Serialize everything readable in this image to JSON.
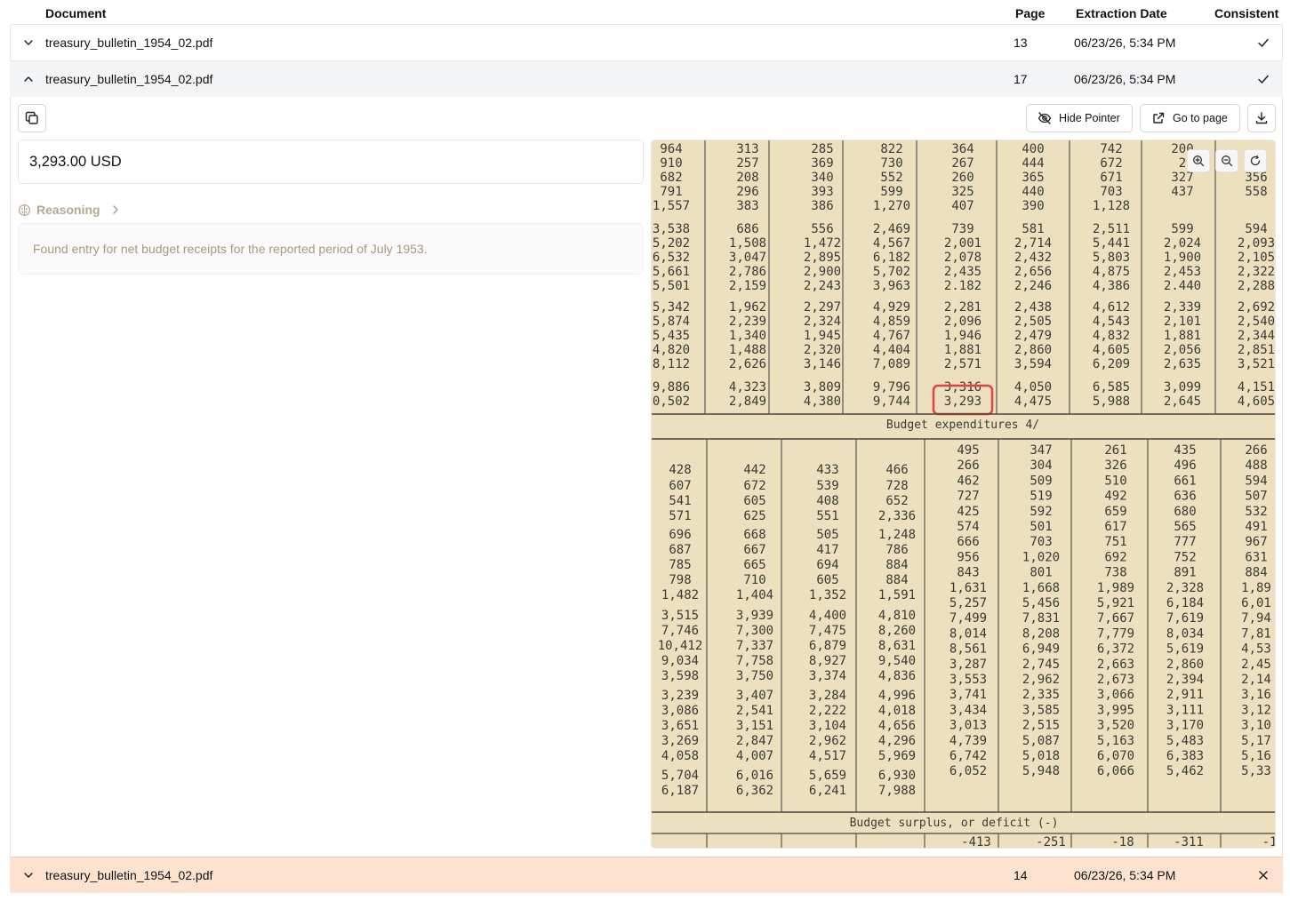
{
  "table": {
    "columns": {
      "document": "Document",
      "page": "Page",
      "extraction_date": "Extraction Date",
      "consistent": "Consistent"
    },
    "rows": [
      {
        "document": "treasury_bulletin_1954_02.pdf",
        "page": "13",
        "date": "06/23/26, 5:34 PM",
        "consistent": true,
        "expanded": false
      },
      {
        "document": "treasury_bulletin_1954_02.pdf",
        "page": "17",
        "date": "06/23/26, 5:34 PM",
        "consistent": true,
        "expanded": true
      },
      {
        "document": "treasury_bulletin_1954_02.pdf",
        "page": "14",
        "date": "06/23/26, 5:34 PM",
        "consistent": false,
        "expanded": false
      }
    ]
  },
  "detail": {
    "hide_pointer_label": "Hide Pointer",
    "go_to_page_label": "Go to page",
    "extracted_value": "3,293.00 USD",
    "reasoning_label": "Reasoning",
    "reasoning_text": "Found entry for net budget receipts for the reported period of July 1953."
  },
  "document_image": {
    "upper_columns": [
      [
        "964",
        "910",
        "682",
        "791",
        "1,557",
        "3,538",
        "5,202",
        "6,532",
        "5,661",
        "5,501",
        "5,342",
        "5,874",
        "5,435",
        "4,820",
        "8,112",
        "9,886",
        "0,502"
      ],
      [
        "313",
        "257",
        "208",
        "296",
        "383",
        "686",
        "1,508",
        "3,047",
        "2,786",
        "2,159",
        "1,962",
        "2,239",
        "1,340",
        "1,488",
        "2,626",
        "4,323",
        "2,849"
      ],
      [
        "285",
        "369",
        "340",
        "393",
        "386",
        "556",
        "1,472",
        "2,895",
        "2,900",
        "2,243",
        "2,297",
        "2,324",
        "1,945",
        "2,320",
        "3,146",
        "3,809",
        "4,380"
      ],
      [
        "822",
        "730",
        "552",
        "599",
        "1,270",
        "2,469",
        "4,567",
        "6,182",
        "5,702",
        "3,963",
        "4,929",
        "4,859",
        "4,767",
        "4,404",
        "7,089",
        "9,796",
        "9,744"
      ],
      [
        "364",
        "267",
        "260",
        "325",
        "407",
        "739",
        "2,001",
        "2,078",
        "2,435",
        "2.182",
        "2,281",
        "2,096",
        "1,946",
        "1,881",
        "2,571",
        "3,316",
        "3,293"
      ],
      [
        "400",
        "444",
        "365",
        "440",
        "390",
        "581",
        "2,714",
        "2,432",
        "2,656",
        "2,246",
        "2,438",
        "2,505",
        "2,479",
        "2,860",
        "3,594",
        "4,050",
        "4,475"
      ],
      [
        "742",
        "672",
        "671",
        "703",
        "1,128",
        "2,511",
        "5,441",
        "5,803",
        "4,875",
        "4,386",
        "4,612",
        "4,543",
        "4,832",
        "4,605",
        "6,209",
        "6,585",
        "5,988"
      ],
      [
        "200",
        "2",
        "327",
        "437",
        "",
        "599",
        "2,024",
        "1,900",
        "2,453",
        "2.440",
        "2,339",
        "2,101",
        "1,881",
        "2,056",
        "2,635",
        "3,099",
        "2,645"
      ],
      [
        "",
        "",
        "356",
        "558",
        "",
        "594",
        "2,093",
        "2,105",
        "2,322",
        "2,288",
        "2,692",
        "2,540",
        "2,344",
        "2,851",
        "3,521",
        "4,151",
        "4,605"
      ]
    ],
    "section_expenditures": "Budget expenditures 4/",
    "lower_columns": [
      [
        "428",
        "607",
        "541",
        "571",
        "696",
        "687",
        "785",
        "798",
        "1,482",
        "3,515",
        "7,746",
        "10,412",
        "9,034",
        "3,598",
        "3,239",
        "3,086",
        "3,651",
        "3,269",
        "4,058",
        "5,704",
        "6,187"
      ],
      [
        "442",
        "672",
        "605",
        "625",
        "668",
        "667",
        "665",
        "710",
        "1,404",
        "3,939",
        "7,300",
        "7,337",
        "7,758",
        "3,750",
        "3,407",
        "2,541",
        "3,151",
        "2,847",
        "4,007",
        "6,016",
        "6,362"
      ],
      [
        "433",
        "539",
        "408",
        "551",
        "505",
        "417",
        "694",
        "605",
        "1,352",
        "4,400",
        "7,475",
        "6,879",
        "8,927",
        "3,374",
        "3,284",
        "2,222",
        "3,104",
        "2,962",
        "4,517",
        "5,659",
        "6,241"
      ],
      [
        "466",
        "728",
        "652",
        "2,336",
        "1,248",
        "786",
        "884",
        "884",
        "1,591",
        "4,810",
        "8,260",
        "8,631",
        "9,540",
        "4,836",
        "4,996",
        "4,018",
        "4,656",
        "4,296",
        "5,969",
        "6,930",
        "7,988"
      ],
      [
        "495",
        "266",
        "462",
        "727",
        "425",
        "574",
        "666",
        "956",
        "843",
        "1,631",
        "5,257",
        "7,499",
        "8,014",
        "8,561",
        "3,287",
        "3,553",
        "3,741",
        "3,434",
        "3,013",
        "4,739",
        "6,742",
        "6,052"
      ],
      [
        "347",
        "304",
        "509",
        "519",
        "592",
        "501",
        "703",
        "1,020",
        "801",
        "1,668",
        "5,456",
        "7,831",
        "8,208",
        "6,949",
        "2,745",
        "2,962",
        "2,335",
        "3,585",
        "2,515",
        "5,087",
        "5,018",
        "5,948"
      ],
      [
        "261",
        "326",
        "510",
        "492",
        "659",
        "617",
        "751",
        "692",
        "738",
        "1,989",
        "5,921",
        "7,667",
        "7,779",
        "6,372",
        "2,663",
        "2,673",
        "3,066",
        "3,995",
        "3,520",
        "5,163",
        "6,070",
        "6,066"
      ],
      [
        "435",
        "496",
        "661",
        "636",
        "680",
        "565",
        "777",
        "752",
        "891",
        "2,328",
        "6,184",
        "7,619",
        "8,034",
        "5,619",
        "2,860",
        "2,394",
        "2,911",
        "3,111",
        "3,170",
        "5,483",
        "6,383",
        "5,462"
      ],
      [
        "266",
        "488",
        "594",
        "507",
        "532",
        "491",
        "967",
        "631",
        "884",
        "1,89",
        "6,01",
        "7,94",
        "7,81",
        "4,53",
        "2,45",
        "2,14",
        "3,16",
        "3,12",
        "3,10",
        "5,17",
        "5,16",
        "5,33"
      ]
    ],
    "section_surplus": "Budget surplus, or deficit (-)",
    "bottom_values": [
      "-413",
      "-251",
      "-18",
      "-311",
      "-1"
    ],
    "highlighted_value": "3,293"
  }
}
